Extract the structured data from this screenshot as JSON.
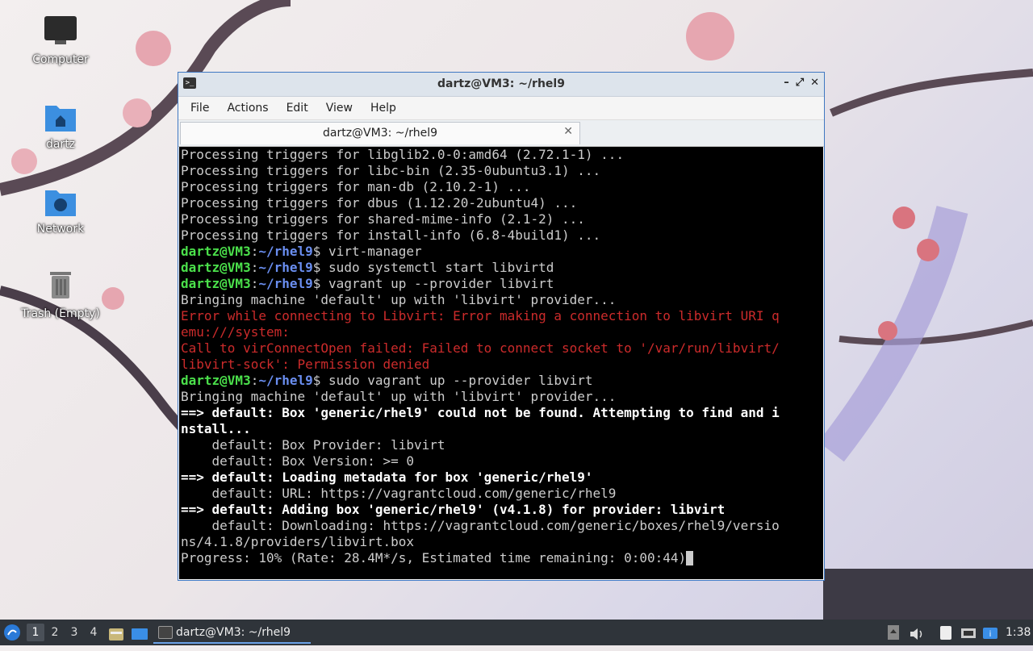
{
  "desktop": {
    "icons": [
      {
        "label": "Computer"
      },
      {
        "label": "dartz"
      },
      {
        "label": "Network"
      },
      {
        "label": "Trash (Empty)"
      }
    ]
  },
  "window": {
    "title": "dartz@VM3: ~/rhel9",
    "controls": {
      "minimize": "–",
      "maximize": "⤢",
      "close": "✕"
    },
    "menu": [
      "File",
      "Actions",
      "Edit",
      "View",
      "Help"
    ],
    "tab": {
      "label": "dartz@VM3: ~/rhel9",
      "close": "✕"
    }
  },
  "terminal": {
    "prompt_user": "dartz@VM3",
    "prompt_path": "~/rhel9",
    "lines": [
      {
        "type": "out",
        "text": "Processing triggers for libglib2.0-0:amd64 (2.72.1-1) ..."
      },
      {
        "type": "out",
        "text": "Processing triggers for libc-bin (2.35-0ubuntu3.1) ..."
      },
      {
        "type": "out",
        "text": "Processing triggers for man-db (2.10.2-1) ..."
      },
      {
        "type": "out",
        "text": "Processing triggers for dbus (1.12.20-2ubuntu4) ..."
      },
      {
        "type": "out",
        "text": "Processing triggers for shared-mime-info (2.1-2) ..."
      },
      {
        "type": "out",
        "text": "Processing triggers for install-info (6.8-4build1) ..."
      },
      {
        "type": "cmd",
        "text": "virt-manager"
      },
      {
        "type": "cmd",
        "text": "sudo systemctl start libvirtd"
      },
      {
        "type": "cmd",
        "text": "vagrant up --provider libvirt"
      },
      {
        "type": "out",
        "text": "Bringing machine 'default' up with 'libvirt' provider..."
      },
      {
        "type": "err",
        "text": "Error while connecting to Libvirt: Error making a connection to libvirt URI q"
      },
      {
        "type": "err",
        "text": "emu:///system:"
      },
      {
        "type": "err",
        "text": "Call to virConnectOpen failed: Failed to connect socket to '/var/run/libvirt/"
      },
      {
        "type": "err",
        "text": "libvirt-sock': Permission denied"
      },
      {
        "type": "cmd",
        "text": "sudo vagrant up --provider libvirt"
      },
      {
        "type": "out",
        "text": "Bringing machine 'default' up with 'libvirt' provider..."
      },
      {
        "type": "bold",
        "text": "==> default: Box 'generic/rhel9' could not be found. Attempting to find and i"
      },
      {
        "type": "bold",
        "text": "nstall..."
      },
      {
        "type": "out",
        "text": "    default: Box Provider: libvirt"
      },
      {
        "type": "out",
        "text": "    default: Box Version: >= 0"
      },
      {
        "type": "bold",
        "text": "==> default: Loading metadata for box 'generic/rhel9'"
      },
      {
        "type": "out",
        "text": "    default: URL: https://vagrantcloud.com/generic/rhel9"
      },
      {
        "type": "bold",
        "text": "==> default: Adding box 'generic/rhel9' (v4.1.8) for provider: libvirt"
      },
      {
        "type": "out",
        "text": "    default: Downloading: https://vagrantcloud.com/generic/boxes/rhel9/versio"
      },
      {
        "type": "out",
        "text": "ns/4.1.8/providers/libvirt.box"
      },
      {
        "type": "cursor",
        "text": "Progress: 10% (Rate: 28.4M*/s, Estimated time remaining: 0:00:44)"
      }
    ]
  },
  "taskbar": {
    "workspaces": [
      "1",
      "2",
      "3",
      "4"
    ],
    "active_workspace": "1",
    "task_label": "dartz@VM3: ~/rhel9",
    "clock": "1:38"
  }
}
